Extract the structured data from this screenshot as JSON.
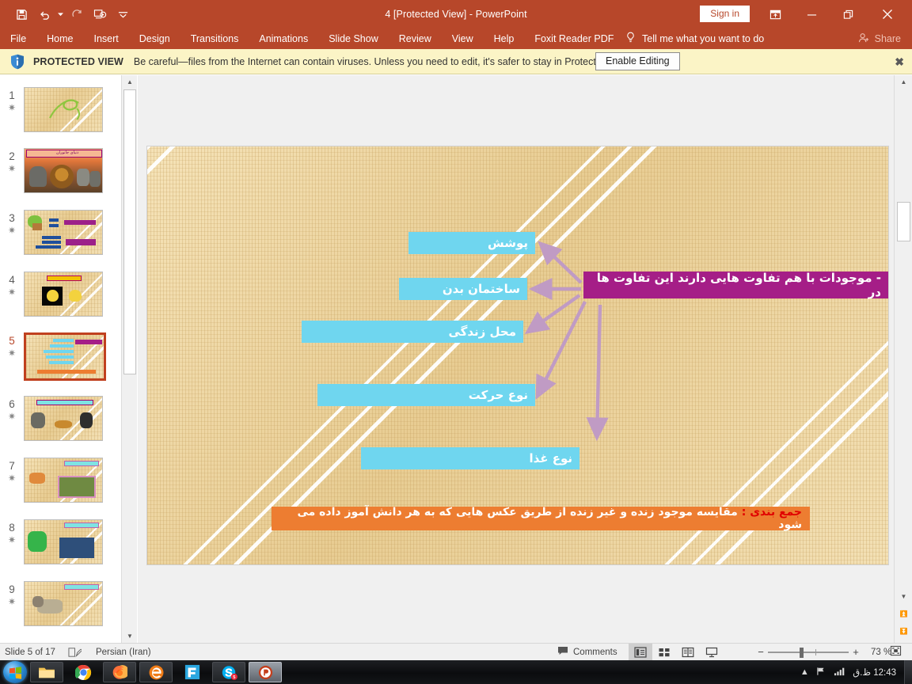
{
  "window": {
    "title": "4 [Protected View]  -  PowerPoint",
    "sign_in": "Sign in",
    "accent_color": "#b7472a",
    "qat": [
      {
        "name": "save-icon",
        "label": "Save"
      },
      {
        "name": "undo-icon",
        "label": "Undo"
      },
      {
        "name": "redo-icon",
        "label": "Redo"
      },
      {
        "name": "start-from-beginning-icon",
        "label": "Start From Beginning"
      },
      {
        "name": "customize-quick-access-toolbar-icon",
        "label": "Customize Quick Access Toolbar"
      }
    ],
    "controls": {
      "ribbon_display": "Ribbon Display Options",
      "minimize": "Minimize",
      "restore": "Restore Down",
      "close": "Close"
    }
  },
  "ribbon": {
    "tabs": [
      {
        "label": "File"
      },
      {
        "label": "Home"
      },
      {
        "label": "Insert"
      },
      {
        "label": "Design"
      },
      {
        "label": "Transitions"
      },
      {
        "label": "Animations"
      },
      {
        "label": "Slide Show"
      },
      {
        "label": "Review"
      },
      {
        "label": "View"
      },
      {
        "label": "Help"
      },
      {
        "label": "Foxit Reader PDF"
      }
    ],
    "tell_me": "Tell me what you want to do",
    "share": "Share"
  },
  "protected_view": {
    "label": "PROTECTED VIEW",
    "message": "Be careful—files from the Internet can contain viruses. Unless you need to edit, it's safer to stay in Protected View.",
    "enable_button": "Enable Editing",
    "close": "✖",
    "bar_color": "#fbf4c6"
  },
  "thumbnails": {
    "slides": [
      {
        "number": "1",
        "star": "✷"
      },
      {
        "number": "2",
        "star": "✷",
        "title": "دنیای جانوران"
      },
      {
        "number": "3",
        "star": "✷"
      },
      {
        "number": "4",
        "star": "✷"
      },
      {
        "number": "5",
        "star": "✷",
        "selected": true
      },
      {
        "number": "6",
        "star": "✷"
      },
      {
        "number": "7",
        "star": "✷"
      },
      {
        "number": "8",
        "star": "✷"
      },
      {
        "number": "9",
        "star": "✷"
      }
    ]
  },
  "slide": {
    "background_color": "#e9cf96",
    "title_box": {
      "text": "- موجودات با هم تفاوت هایی دارند این تفاوت ها در",
      "color": "#a51e87"
    },
    "items": [
      {
        "text": "پوشش",
        "color": "#6fd6ef"
      },
      {
        "text": "ساختمان بدن",
        "color": "#6fd6ef"
      },
      {
        "text": "محل زندگی",
        "color": "#6fd6ef"
      },
      {
        "text": "نوع حرکت",
        "color": "#6fd6ef"
      },
      {
        "text": "نوع غذا",
        "color": "#6fd6ef"
      }
    ],
    "summary": {
      "label": "جمع بندی :",
      "text": " مقایسه موجود زنده و غیر زنده از طریق عکس هایی که به هر دانش آموز داده می شود",
      "color": "#ed7d31",
      "label_color": "#e00000"
    },
    "connector_color": "#c09bc4"
  },
  "status_bar": {
    "slide_counter": "Slide 5 of 17",
    "notes_icon": "notes-icon",
    "language": "Persian (Iran)",
    "comments": "Comments",
    "views": [
      {
        "name": "normal-view-button",
        "label": "Normal",
        "selected": true
      },
      {
        "name": "slide-sorter-view-button",
        "label": "Slide Sorter",
        "selected": false
      },
      {
        "name": "reading-view-button",
        "label": "Reading View",
        "selected": false
      },
      {
        "name": "slide-show-button",
        "label": "Slide Show",
        "selected": false
      }
    ],
    "zoom_out": "−",
    "zoom_in": "+",
    "zoom_level": "73 %",
    "fit_to_window": "Fit slide to current window"
  },
  "taskbar": {
    "start": "Start",
    "items": [
      {
        "name": "file-explorer-icon",
        "label": "File Explorer"
      },
      {
        "name": "google-chrome-icon",
        "label": "Google Chrome"
      },
      {
        "name": "firefox-icon",
        "label": "Mozilla Firefox"
      },
      {
        "name": "internet-explorer-icon",
        "label": "Internet Explorer"
      },
      {
        "name": "foxit-reader-icon",
        "label": "Foxit Reader"
      },
      {
        "name": "skype-icon",
        "label": "Skype",
        "badge": "5"
      },
      {
        "name": "powerpoint-icon",
        "label": "PowerPoint",
        "active": true
      }
    ],
    "tray": {
      "show_hidden": "▲",
      "network_icon": "network-icon",
      "signal_icon": "signal-icon",
      "clock": "12:43 ظ.ق"
    }
  }
}
